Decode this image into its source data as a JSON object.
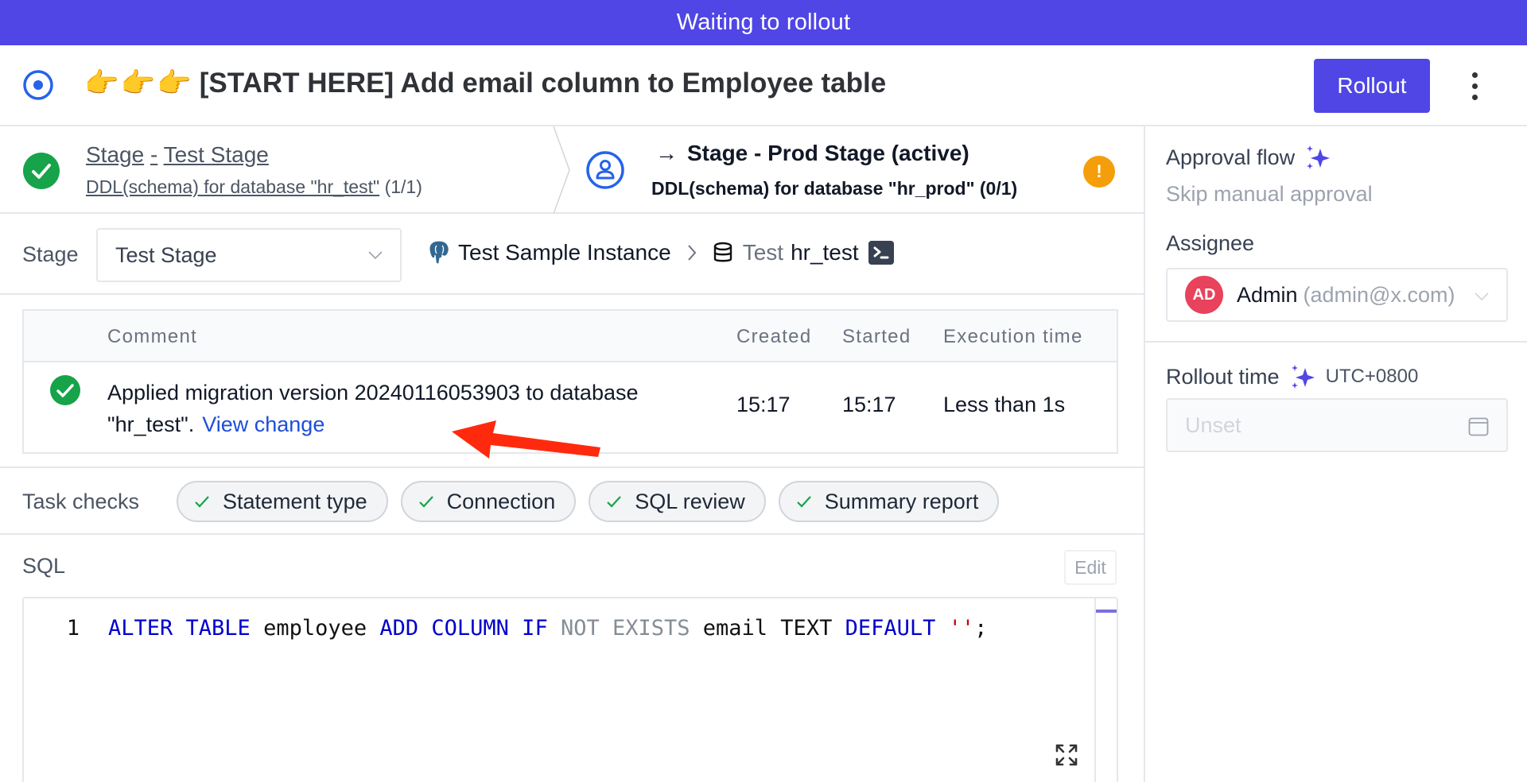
{
  "banner": {
    "text": "Waiting to rollout",
    "color": "#4f46e5"
  },
  "header": {
    "status_icon": "in-progress-circle-icon",
    "pointer_emoji": [
      "👉",
      "👉",
      "👉"
    ],
    "title": "[START HERE] Add email column to Employee table",
    "rollout_label": "Rollout",
    "more_icon": "more-vertical-icon"
  },
  "stages": [
    {
      "prefix": "Stage",
      "dash": "-",
      "name": "Test Stage",
      "task": "DDL(schema) for database \"hr_test\"",
      "progress": "(1/1)",
      "status": "done",
      "icon": "check-circle-icon"
    },
    {
      "arrow": "→",
      "title": "Stage - Prod Stage (active)",
      "task": "DDL(schema) for database \"hr_prod\"",
      "progress": "(0/1)",
      "status": "active",
      "icon": "user-circle-icon",
      "badge_icon": "warning-icon",
      "badge_text": "!"
    }
  ],
  "stage_selector": {
    "label": "Stage",
    "value": "Test Stage"
  },
  "breadcrumb": {
    "instance": "Test Sample Instance",
    "environment": "Test",
    "database": "hr_test"
  },
  "task_runs": {
    "columns": [
      "Comment",
      "Created",
      "Started",
      "Execution time"
    ],
    "rows": [
      {
        "status": "done",
        "comment": "Applied migration version 20240116053903 to database \"hr_test\".",
        "link": "View change",
        "created": "15:17",
        "started": "15:17",
        "execution_time": "Less than 1s"
      }
    ]
  },
  "task_checks": {
    "label": "Task checks",
    "items": [
      {
        "label": "Statement type",
        "status": "success"
      },
      {
        "label": "Connection",
        "status": "success"
      },
      {
        "label": "SQL review",
        "status": "success"
      },
      {
        "label": "Summary report",
        "status": "success"
      }
    ]
  },
  "sql": {
    "label": "SQL",
    "edit_label": "Edit",
    "line_number": "1",
    "tokens": [
      {
        "t": "ALTER TABLE",
        "c": "kw"
      },
      {
        "t": " employee ",
        "c": "plain"
      },
      {
        "t": "ADD COLUMN IF",
        "c": "kw"
      },
      {
        "t": " NOT EXISTS",
        "c": "kw2"
      },
      {
        "t": " email TEXT ",
        "c": "plain"
      },
      {
        "t": "DEFAULT",
        "c": "kw"
      },
      {
        "t": " ''",
        "c": "str"
      },
      {
        "t": ";",
        "c": "plain"
      }
    ]
  },
  "sidebar": {
    "approval_flow_label": "Approval flow",
    "approval_flow_value": "Skip manual approval",
    "assignee_label": "Assignee",
    "assignee": {
      "initials": "AD",
      "name": "Admin",
      "email": "(admin@x.com)",
      "avatar_color": "#e8425c"
    },
    "rollout_time_label": "Rollout time",
    "timezone": "UTC+0800",
    "rollout_time_placeholder": "Unset"
  }
}
